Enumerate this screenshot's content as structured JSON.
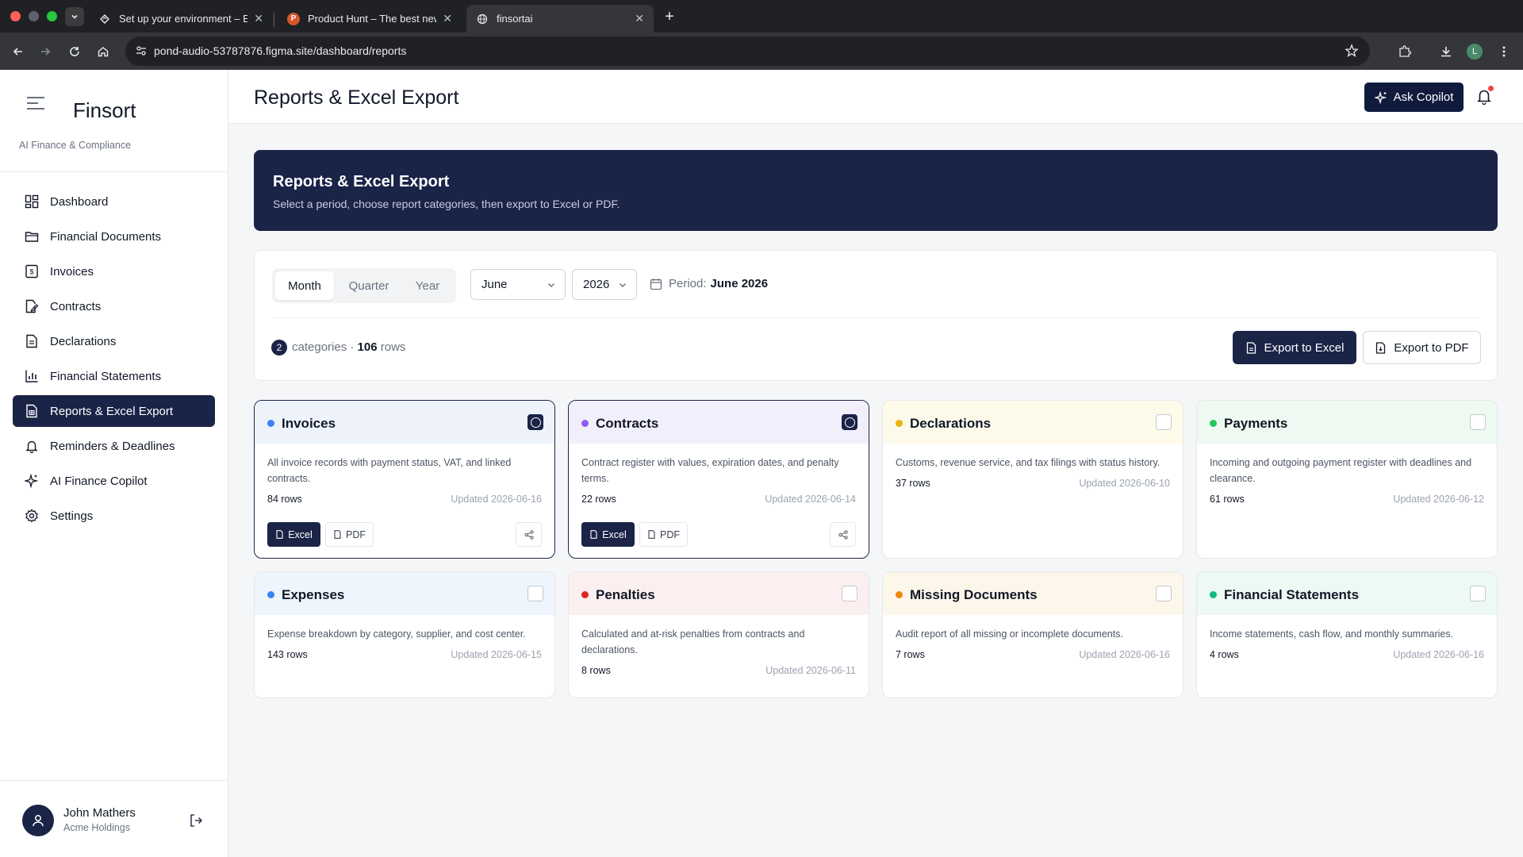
{
  "browser": {
    "tabs": [
      {
        "title": "Set up your environment – Ex",
        "favicon": "figma-icon"
      },
      {
        "title": "Product Hunt – The best new",
        "favicon": "producthunt-icon",
        "favicon_letter": "P"
      },
      {
        "title": "finsortai",
        "favicon": "globe-icon"
      }
    ],
    "url": "pond-audio-53787876.figma.site/dashboard/reports",
    "profile_letter": "L"
  },
  "sidebar": {
    "brand": "Finsort",
    "subtitle": "AI Finance & Compliance",
    "items": [
      {
        "label": "Dashboard",
        "icon": "dashboard-icon"
      },
      {
        "label": "Financial Documents",
        "icon": "folder-icon"
      },
      {
        "label": "Invoices",
        "icon": "invoice-icon"
      },
      {
        "label": "Contracts",
        "icon": "contract-icon"
      },
      {
        "label": "Declarations",
        "icon": "document-icon"
      },
      {
        "label": "Financial Statements",
        "icon": "bar-chart-icon"
      },
      {
        "label": "Reports & Excel Export",
        "icon": "report-icon",
        "active": true
      },
      {
        "label": "Reminders & Deadlines",
        "icon": "bell-icon"
      },
      {
        "label": "AI Finance Copilot",
        "icon": "sparkle-icon"
      },
      {
        "label": "Settings",
        "icon": "gear-icon"
      }
    ],
    "user": {
      "name": "John Mathers",
      "org": "Acme Holdings"
    }
  },
  "header": {
    "title": "Reports & Excel Export",
    "copilot_label": "Ask Copilot"
  },
  "hero": {
    "title": "Reports & Excel Export",
    "subtitle": "Select a period, choose report categories, then export to Excel or PDF."
  },
  "filters": {
    "period_types": [
      "Month",
      "Quarter",
      "Year"
    ],
    "active_period_type": "Month",
    "month": "June",
    "year": "2026",
    "period_label": "Period:",
    "period_value": "June 2026",
    "selected_count": "2",
    "categories_label": "categories ·",
    "total_rows": "106",
    "rows_label": "rows",
    "export_excel_label": "Export to Excel",
    "export_pdf_label": "Export to PDF"
  },
  "cards": [
    {
      "title": "Invoices",
      "color": "#3b82f6",
      "tint": "#eef2fb",
      "selected": true,
      "description": "All invoice records with payment status, VAT, and linked contracts.",
      "rows": "84 rows",
      "updated": "Updated 2026-06-16",
      "excel_label": "Excel",
      "pdf_label": "PDF"
    },
    {
      "title": "Contracts",
      "color": "#8b5cf6",
      "tint": "#f1effb",
      "selected": true,
      "description": "Contract register with values, expiration dates, and penalty terms.",
      "rows": "22 rows",
      "updated": "Updated 2026-06-14",
      "excel_label": "Excel",
      "pdf_label": "PDF"
    },
    {
      "title": "Declarations",
      "color": "#eab308",
      "tint": "#fdfaea",
      "selected": false,
      "description": "Customs, revenue service, and tax filings with status history.",
      "rows": "37 rows",
      "updated": "Updated 2026-06-10"
    },
    {
      "title": "Payments",
      "color": "#22c55e",
      "tint": "#eefaf1",
      "selected": false,
      "description": "Incoming and outgoing payment register with deadlines and clearance.",
      "rows": "61 rows",
      "updated": "Updated 2026-06-12"
    },
    {
      "title": "Expenses",
      "color": "#3b82f6",
      "tint": "#eef5fc",
      "selected": false,
      "description": "Expense breakdown by category, supplier, and cost center.",
      "rows": "143 rows",
      "updated": "Updated 2026-06-15"
    },
    {
      "title": "Penalties",
      "color": "#dc2626",
      "tint": "#fcefef",
      "selected": false,
      "description": "Calculated and at-risk penalties from contracts and declarations.",
      "rows": "8 rows",
      "updated": "Updated 2026-06-11"
    },
    {
      "title": "Missing Documents",
      "color": "#ea8a0c",
      "tint": "#fdf6ea",
      "selected": false,
      "description": "Audit report of all missing or incomplete documents.",
      "rows": "7 rows",
      "updated": "Updated 2026-06-16"
    },
    {
      "title": "Financial Statements",
      "color": "#10b981",
      "tint": "#edf9f3",
      "selected": false,
      "description": "Income statements, cash flow, and monthly summaries.",
      "rows": "4 rows",
      "updated": "Updated 2026-06-16"
    }
  ]
}
